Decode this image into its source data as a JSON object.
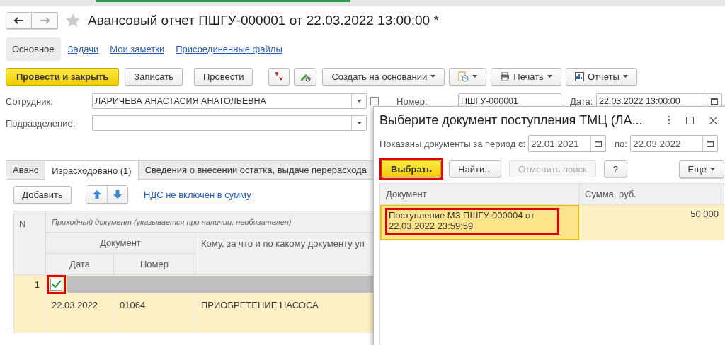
{
  "window": {
    "title": "Авансовый отчет ПШГУ-000001 от 22.03.2022 13:00:00 *",
    "favorite": false
  },
  "sections": [
    {
      "label": "Основное",
      "selected": true
    },
    {
      "label": "Задачи",
      "selected": false
    },
    {
      "label": "Мои заметки",
      "selected": false
    },
    {
      "label": "Присоединенные файлы",
      "selected": false
    }
  ],
  "toolbar": [
    {
      "kind": "primary",
      "label": "Провести и закрыть"
    },
    {
      "kind": "button",
      "label": "Записать"
    },
    {
      "kind": "button",
      "label": "Провести"
    },
    {
      "kind": "dtkt"
    },
    {
      "kind": "pencil"
    },
    {
      "kind": "menu",
      "label": "Создать на основании"
    },
    {
      "kind": "iconmenu"
    },
    {
      "kind": "print",
      "label": "Печать"
    },
    {
      "kind": "reports",
      "label": "Отчеты"
    }
  ],
  "employee": {
    "label": "Сотрудник:",
    "value": "ЛАРИЧЕВА АНАСТАСИЯ АНАТОЛЬЕВНА"
  },
  "number": {
    "label": "Номер:",
    "value": "ПШГУ-000001"
  },
  "date": {
    "label": "Дата:",
    "value": "22.03.2022 13:00:00"
  },
  "department": {
    "label": "Подразделение:"
  },
  "tabs": [
    {
      "label": "Аванс",
      "selected": false
    },
    {
      "label": "Израсходовано (1)",
      "selected": true
    },
    {
      "label": "Сведения о внесении остатка, выдаче перерасхода",
      "selected": false
    }
  ],
  "table_toolbar": {
    "add": "Добавить",
    "vat_link": "НДС не включен в сумму"
  },
  "table": {
    "n_header": "N",
    "group_header": "Приходный документ (указывается при наличии, необязателен)",
    "document_header": "Документ",
    "date_header": "Дата",
    "number_header": "Номер",
    "purpose_header": "Кому, за что и по какому документу уп",
    "rows": [
      {
        "n": "1",
        "checked": true,
        "highlighted": true,
        "date": "22.03.2022",
        "number": "01064",
        "purpose": "ПРИОБРЕТЕНИЕ НАСОСА",
        "selected": true
      }
    ]
  },
  "dialog": {
    "title": "Выберите документ поступления ТМЦ (ЛА...",
    "period_label": "Показаны документы за период с:",
    "from": "22.01.2021",
    "to_label": "по:",
    "to": "22.03.2022",
    "buttons": [
      {
        "kind": "primary",
        "label": "Выбрать",
        "highlighted": true,
        "disabled": false
      },
      {
        "kind": "button",
        "label": "Найти...",
        "highlighted": false,
        "disabled": false
      },
      {
        "kind": "button",
        "label": "Отменить поиск",
        "highlighted": false,
        "disabled": true
      },
      {
        "kind": "button",
        "label": "?",
        "highlighted": false,
        "disabled": false
      }
    ],
    "more": "Еще",
    "columns": [
      "Документ",
      "Сумма, руб."
    ],
    "rows": [
      {
        "document": "Поступление МЗ ПШГУ-000004 от 22.03.2022 23:59:59",
        "amount": "50 000",
        "selected": true,
        "highlighted": true
      }
    ]
  }
}
